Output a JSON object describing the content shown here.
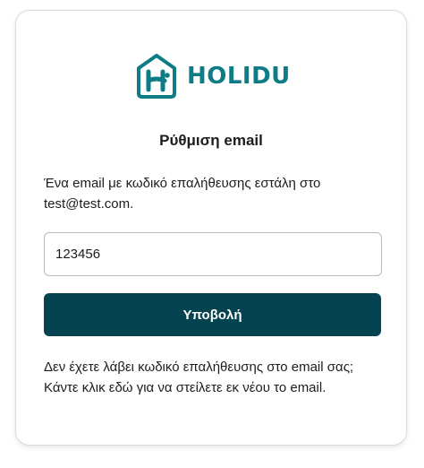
{
  "brand": {
    "name": "HOLIDU",
    "color": "#0e7c86",
    "icon": "house-h-logo-icon"
  },
  "page": {
    "title": "Ρύθμιση email",
    "message": "Ένα email με κωδικό επαλήθευσης εστάλη στο test@test.com."
  },
  "form": {
    "code_value": "123456",
    "submit_label": "Υποβολή",
    "submit_color": "#04434f"
  },
  "footer": {
    "resend_text": "Δεν έχετε λάβει κωδικό επαλήθευσης στο email σας; Κάντε κλικ εδώ για να στείλετε εκ νέου το email."
  }
}
